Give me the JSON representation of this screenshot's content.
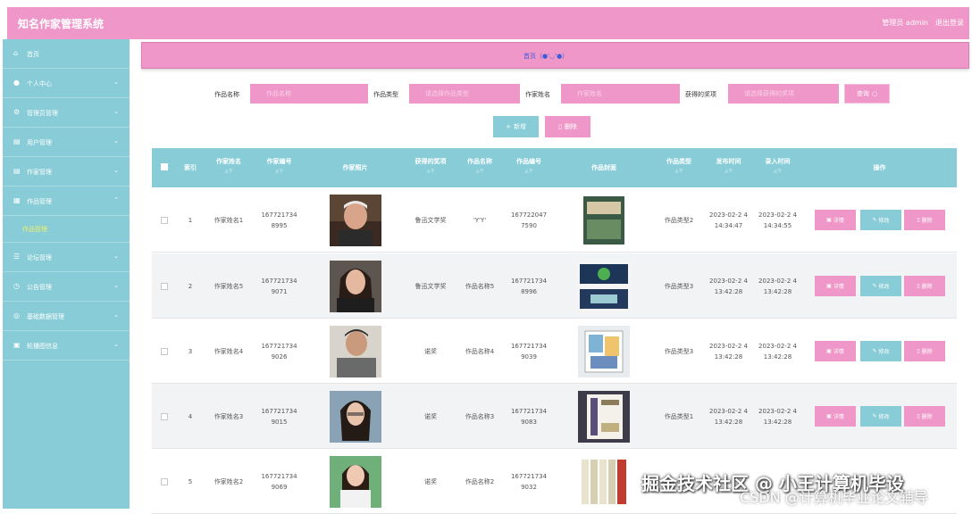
{
  "app": {
    "title": "知名作家管理系统",
    "user": "管理员 admin",
    "logout": "退出登录"
  },
  "sidebar": {
    "items": [
      {
        "label": "首页",
        "icon": "home-icon"
      },
      {
        "label": "个人中心",
        "icon": "user-icon"
      },
      {
        "label": "管理员管理",
        "icon": "settings-icon"
      },
      {
        "label": "用户管理",
        "icon": "users-icon"
      },
      {
        "label": "作家管理",
        "icon": "pen-icon"
      },
      {
        "label": "作品管理",
        "icon": "book-icon"
      },
      {
        "label": "论坛管理",
        "icon": "forum-icon"
      },
      {
        "label": "公告管理",
        "icon": "notice-icon"
      },
      {
        "label": "基础数据管理",
        "icon": "database-icon"
      },
      {
        "label": "轮播图信息",
        "icon": "carousel-icon"
      }
    ],
    "submenu": {
      "label": "作品管理"
    }
  },
  "breadcrumb": {
    "text": "首页（●'◡'●）"
  },
  "filters": {
    "work_name_label": "作品名称",
    "work_name_placeholder": "作品名称",
    "work_type_label": "作品类型",
    "work_type_placeholder": "请选择作品类型",
    "author_label": "作家姓名",
    "author_placeholder": "作家姓名",
    "award_label": "获得的奖项",
    "award_placeholder": "请选择获得的奖项",
    "query_label": "查询"
  },
  "actions": {
    "add_label": "新增",
    "delete_label": "删除"
  },
  "table": {
    "headers": [
      "索引",
      "作家姓名",
      "作家编号",
      "作家照片",
      "获得的奖项",
      "作品名称",
      "作品编号",
      "作品封面",
      "作品类型",
      "发布时间",
      "录入时间",
      "操作"
    ],
    "ops": {
      "detail": "详情",
      "edit": "修改",
      "delete": "删除"
    },
    "rows": [
      {
        "index": "1",
        "author": "作家姓名1",
        "author_no": "167721734 8995",
        "award": "鲁迅文学奖",
        "work_name": "'Y'Y'",
        "work_no": "167722047 7590",
        "work_type": "作品类型2",
        "publish": "2023-02-2 4 14:34:47",
        "entry": "2023-02-2 4 14:34:55"
      },
      {
        "index": "2",
        "author": "作家姓名5",
        "author_no": "167721734 9071",
        "award": "鲁迅文学奖",
        "work_name": "作品名称5",
        "work_no": "167721734 8996",
        "work_type": "作品类型3",
        "publish": "2023-02-2 4 13:42:28",
        "entry": "2023-02-2 4 13:42:28"
      },
      {
        "index": "3",
        "author": "作家姓名4",
        "author_no": "167721734 9026",
        "award": "诺奖",
        "work_name": "作品名称4",
        "work_no": "167721734 9039",
        "work_type": "作品类型3",
        "publish": "2023-02-2 4 13:42:28",
        "entry": "2023-02-2 4 13:42:28"
      },
      {
        "index": "4",
        "author": "作家姓名3",
        "author_no": "167721734 9015",
        "award": "诺奖",
        "work_name": "作品名称3",
        "work_no": "167721734 9083",
        "work_type": "作品类型1",
        "publish": "2023-02-2 4 13:42:28",
        "entry": "2023-02-2 4 13:42:28"
      },
      {
        "index": "5",
        "author": "作家姓名2",
        "author_no": "167721734 9069",
        "award": "诺奖",
        "work_name": "作品名称2",
        "work_no": "167721734 9032",
        "work_type": "",
        "publish": "",
        "entry": ""
      }
    ]
  },
  "watermark": {
    "line1": "掘金技术社区 @ 小王计算机毕设",
    "line2": "CSDN @计算机毕业论文辅导"
  },
  "colors": {
    "pink": "#ef97c8",
    "teal": "#87ccd6",
    "link": "#3d5bd9"
  }
}
